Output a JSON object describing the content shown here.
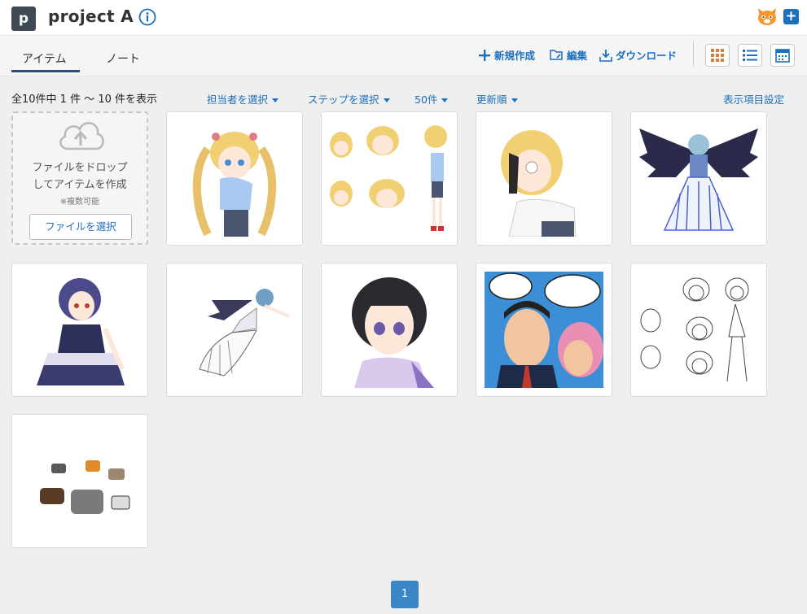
{
  "header": {
    "project_initial": "p",
    "project_name": "project A",
    "info_icon": "info-circle-icon",
    "avatar_icon": "cat-avatar-icon",
    "add_icon": "plus-icon"
  },
  "tabs": [
    {
      "label": "アイテム",
      "active": true
    },
    {
      "label": "ノート",
      "active": false
    }
  ],
  "toolbar": {
    "new_label": "新規作成",
    "edit_label": "編集",
    "download_label": "ダウンロード",
    "view_modes": [
      "grid-view-icon",
      "list-view-icon",
      "calendar-view-icon"
    ]
  },
  "filters": {
    "count_text": "全10件中 1 件 〜 10 件を表示",
    "assignee": "担当者を選択",
    "step": "ステップを選択",
    "per_page": "50件",
    "sort": "更新順",
    "display_settings": "表示項目設定"
  },
  "dropzone": {
    "line1": "ファイルをドロップ",
    "line2": "してアイテムを作成",
    "note": "※複数可能",
    "button": "ファイルを選択"
  },
  "items": [
    {
      "name": "blonde-twintail-girl"
    },
    {
      "name": "blonde-girl-expression-sheet"
    },
    {
      "name": "short-blonde-girl"
    },
    {
      "name": "winged-girl-back-view"
    },
    {
      "name": "purple-gothic-girl"
    },
    {
      "name": "winged-flying-girl"
    },
    {
      "name": "black-bob-hair-girl"
    },
    {
      "name": "pop-art-couple"
    },
    {
      "name": "lineart-expression-sheet"
    },
    {
      "name": "animal-icons"
    }
  ],
  "pagination": {
    "current": "1"
  },
  "colors": {
    "accent": "#1b6fbf",
    "badge": "#3f4a55",
    "pager": "#3b86c6"
  }
}
